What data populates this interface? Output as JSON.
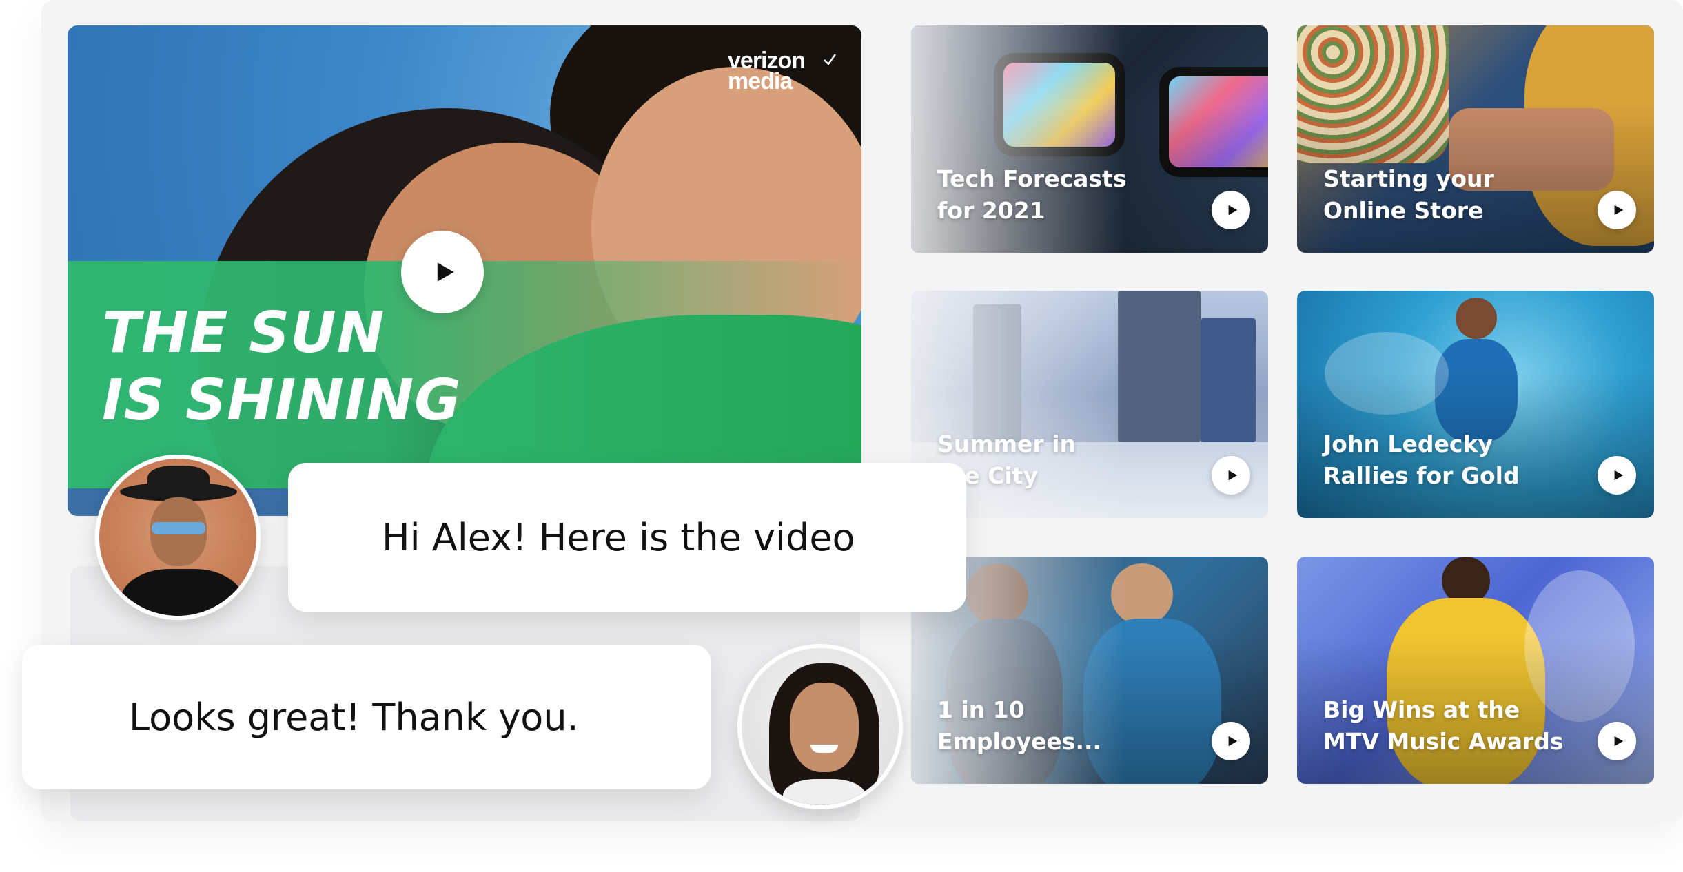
{
  "hero": {
    "brand_line1": "verizon",
    "brand_line2": "media",
    "title_line1": "THE SUN",
    "title_line2": "IS SHINING"
  },
  "videos": [
    {
      "line1": "Tech Forecasts",
      "line2": "for 2021"
    },
    {
      "line1": "Starting your",
      "line2": "Online Store"
    },
    {
      "line1": "Summer in",
      "line2": "the City"
    },
    {
      "line1": "John Ledecky",
      "line2": "Rallies for Gold"
    },
    {
      "line1": "1 in 10",
      "line2": "Employees..."
    },
    {
      "line1": "Big Wins at the",
      "line2": "MTV Music Awards"
    }
  ],
  "chat": {
    "message_1": "Hi Alex! Here is the video",
    "message_2": "Looks great! Thank you."
  },
  "colors": {
    "hero_band": "#2fb76f",
    "hero_sky": "#3d86c8",
    "bubble_bg": "#ffffff",
    "panel_bg": "#f4f4f5"
  },
  "icons": {
    "play": "play-icon",
    "checkmark": "checkmark-icon"
  }
}
